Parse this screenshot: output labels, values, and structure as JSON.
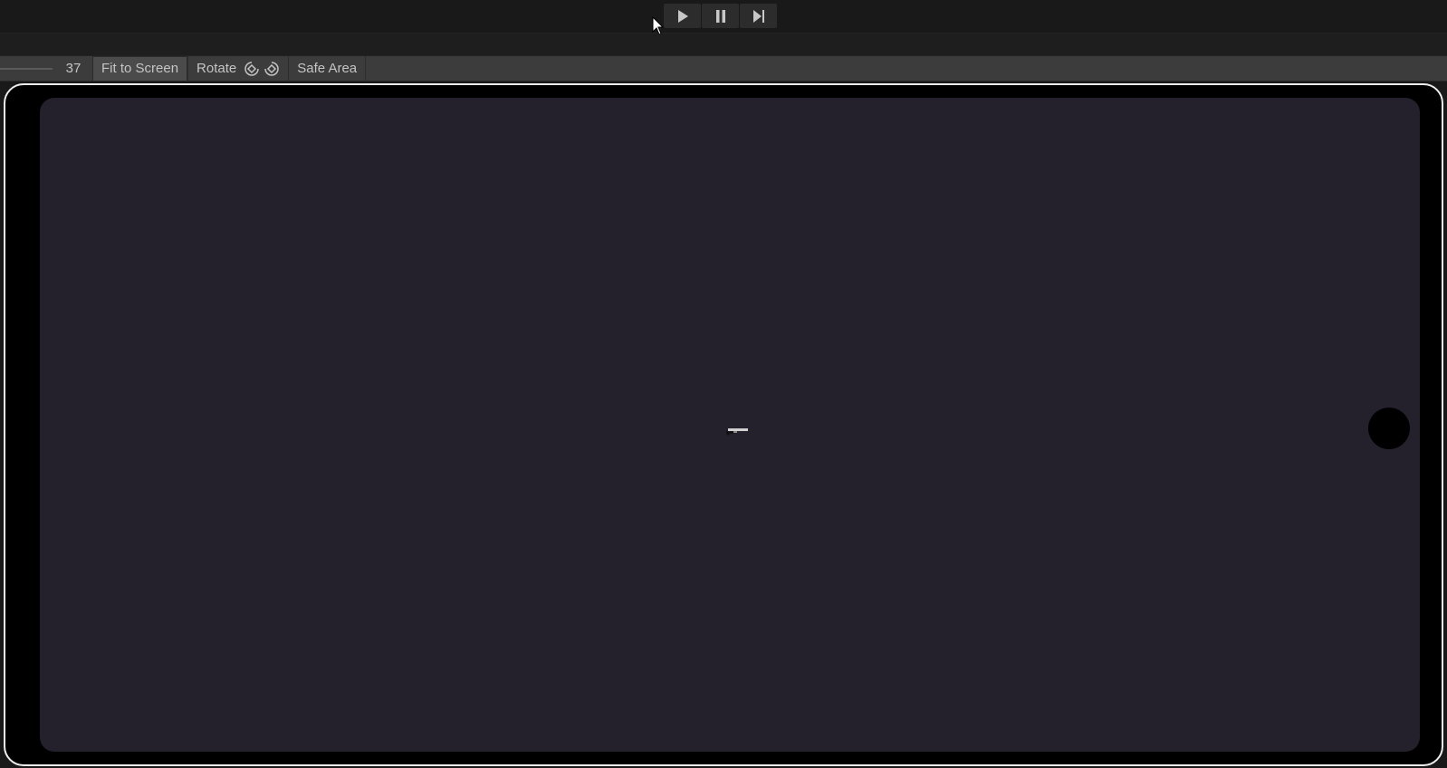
{
  "toolbar": {
    "play_icon": "play-icon",
    "pause_icon": "pause-icon",
    "step_icon": "step-forward-icon"
  },
  "game_view": {
    "scale_value": "37",
    "fit_to_screen_label": "Fit to Screen",
    "rotate_label": "Rotate",
    "safe_area_label": "Safe Area"
  },
  "device": {
    "frame_color": "#ededed",
    "screen_color": "#24202c"
  }
}
